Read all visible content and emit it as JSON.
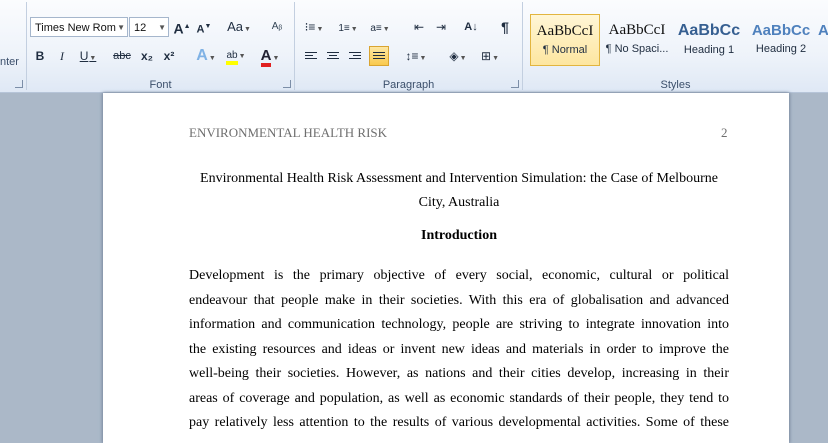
{
  "ribbon": {
    "clipboard_partial_label": "nter",
    "font_group": {
      "label": "Font",
      "font_name": "Times New Rom",
      "font_size": "12",
      "grow_font": "A",
      "shrink_font": "A",
      "change_case": "Aa",
      "bold": "B",
      "italic": "I",
      "underline": "U",
      "strikethrough": "abc",
      "subscript": "x₂",
      "superscript": "x²",
      "text_effects": "A",
      "highlight": "ab",
      "font_color": "A",
      "highlight_color": "#ffff00",
      "font_color_value": "#e02020"
    },
    "paragraph_group": {
      "label": "Paragraph",
      "sort": "A↓",
      "pilcrow": "¶"
    },
    "styles_group": {
      "label": "Styles",
      "items": [
        {
          "sample": "AaBbCcI",
          "name": "¶ Normal"
        },
        {
          "sample": "AaBbCcI",
          "name": "¶ No Spaci..."
        },
        {
          "sample": "AaBbCc",
          "name": "Heading 1"
        },
        {
          "sample": "AaBbCc",
          "name": "Heading 2"
        },
        {
          "sample": "A",
          "name": ""
        }
      ]
    }
  },
  "document": {
    "header_left": "ENVIRONMENTAL HEALTH RISK",
    "page_number": "2",
    "title_line1": "Environmental Health Risk Assessment  and Intervention Simulation: the Case of Melbourne",
    "title_line2": "City, Australia",
    "heading": "Introduction",
    "body_lines": [
      "Development is the primary objective of every social, economic, cultural or political",
      "endeavour that people make in their societies. With this era of globalisation and advanced",
      "information and communication technology, people are striving to integrate innovation into",
      "the existing resources and ideas or invent new ideas and materials in order to improve the",
      "well-being their societies. However, as nations and their cities develop, increasing in their",
      "areas of coverage and population, as well as economic standards of their people, they tend to",
      "pay relatively less attention to the results of various developmental activities. Some of these"
    ]
  }
}
